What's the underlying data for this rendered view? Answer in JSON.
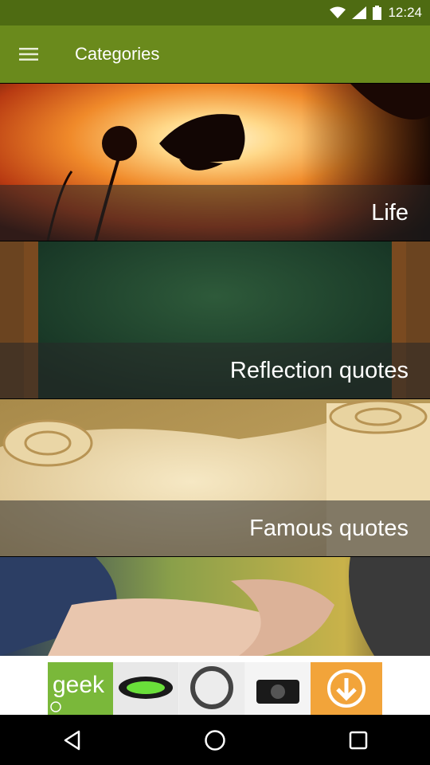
{
  "status_bar": {
    "time": "12:24"
  },
  "app_bar": {
    "title": "Categories"
  },
  "categories": [
    {
      "label": "Life"
    },
    {
      "label": "Reflection quotes"
    },
    {
      "label": "Famous quotes"
    },
    {
      "label": ""
    }
  ],
  "ad": {
    "brand_text": "geek"
  },
  "colors": {
    "status_bar": "#4e6b12",
    "app_bar": "#6a8a1c"
  }
}
